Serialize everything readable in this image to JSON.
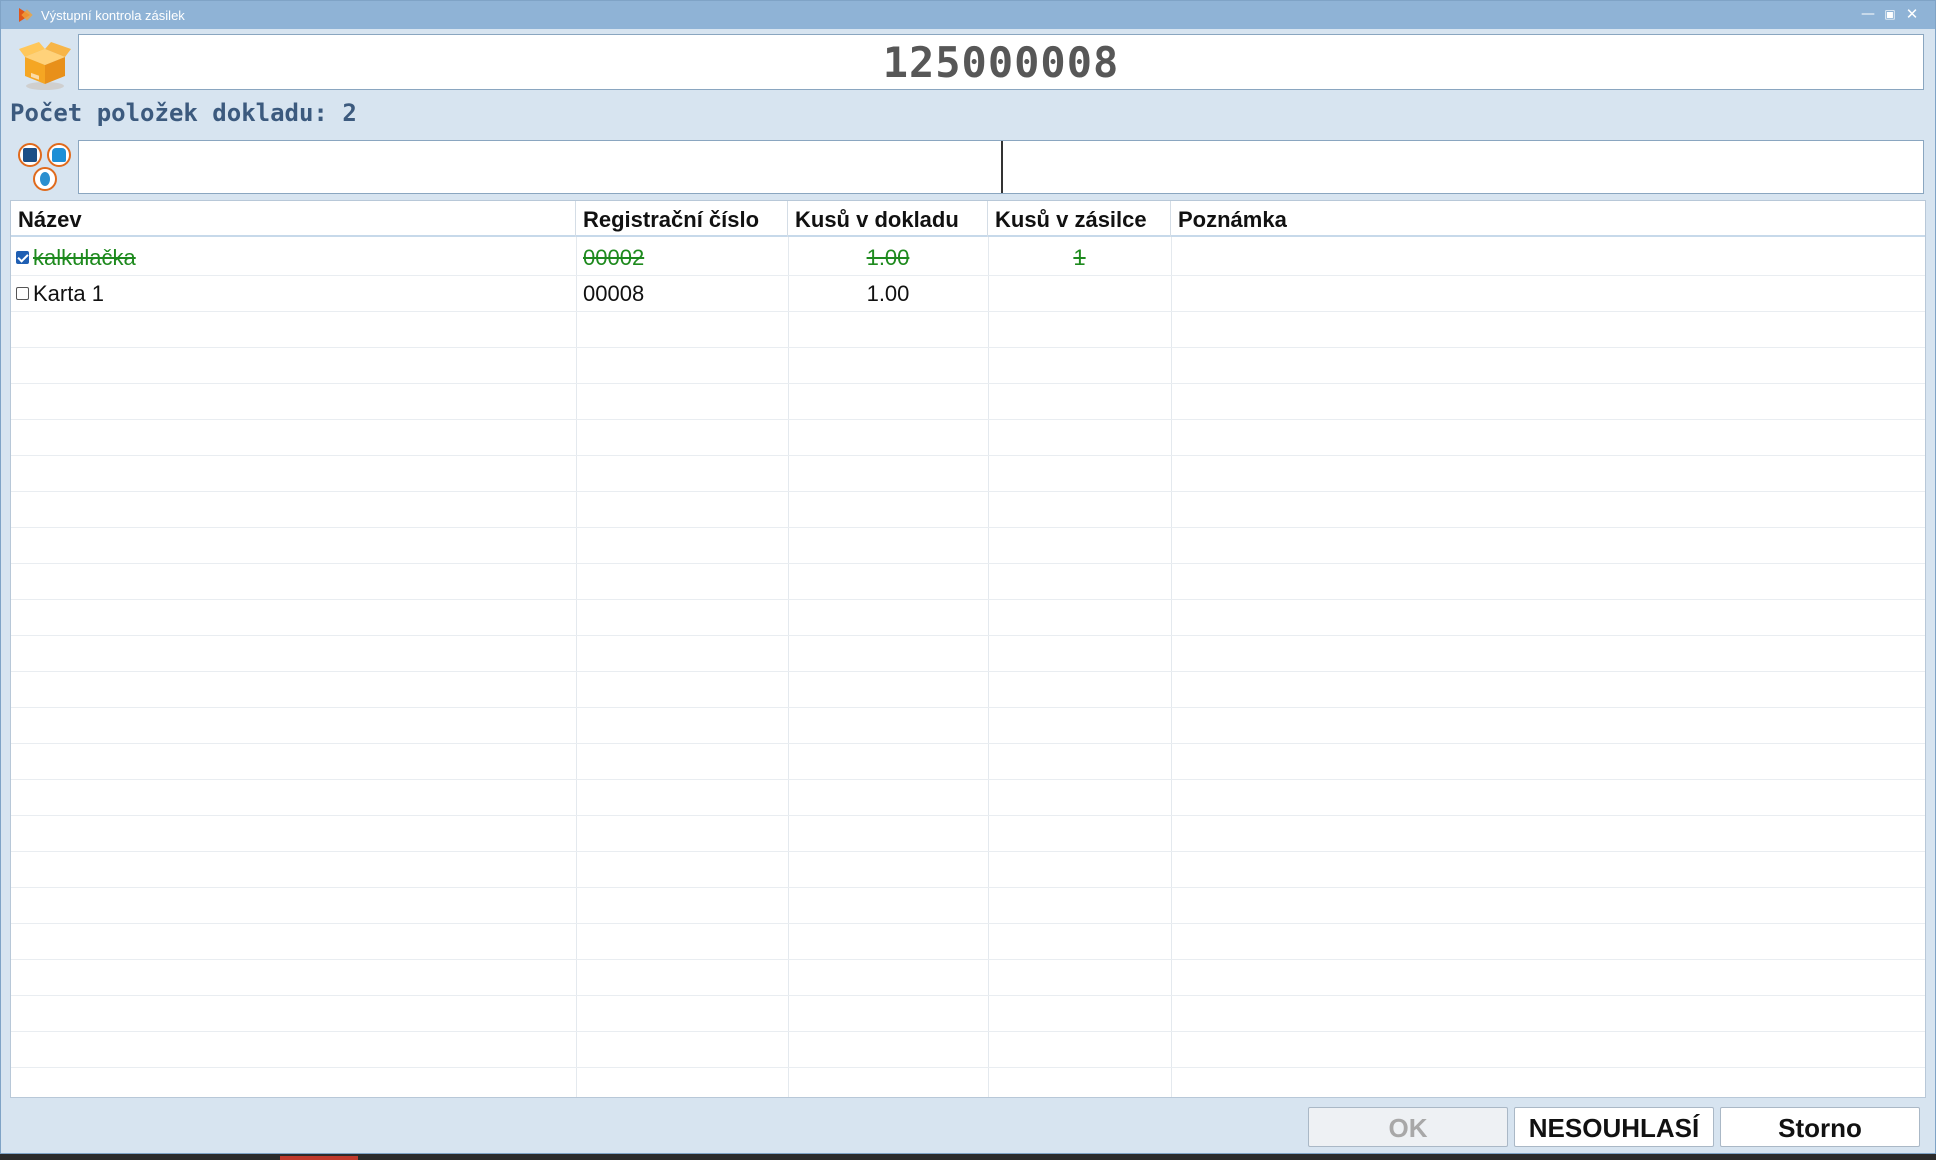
{
  "window": {
    "title": "Výstupní kontrola zásilek",
    "icon": "app-arrow-icon",
    "controls": [
      "minimize",
      "maximize",
      "close"
    ]
  },
  "document": {
    "number": "125000008",
    "icon": "package-box-icon"
  },
  "item_count_label": "Počet položek dokladu: 2",
  "toolbar_icons": [
    "printer-icon",
    "shirt-icon",
    "scale-icon"
  ],
  "scan": {
    "left_value": "",
    "right_value": ""
  },
  "grid": {
    "columns": [
      "Název",
      "Registrační číslo",
      "Kusů v dokladu",
      "Kusů v zásilce",
      "Poznámka"
    ],
    "rows": [
      {
        "checked": true,
        "name": "kalkulačka",
        "reg": "00002",
        "qty": "1.00",
        "ship": "1",
        "note": ""
      },
      {
        "checked": false,
        "name": "Karta 1",
        "reg": "00008",
        "qty": "1.00",
        "ship": "",
        "note": ""
      }
    ]
  },
  "buttons": {
    "ok": "OK",
    "disagree": "NESOUHLASÍ",
    "cancel": "Storno"
  },
  "colors": {
    "done_row": "#1e8a1e",
    "titlebar": "#8fb3d6",
    "accent_orange": "#e06a1c"
  }
}
